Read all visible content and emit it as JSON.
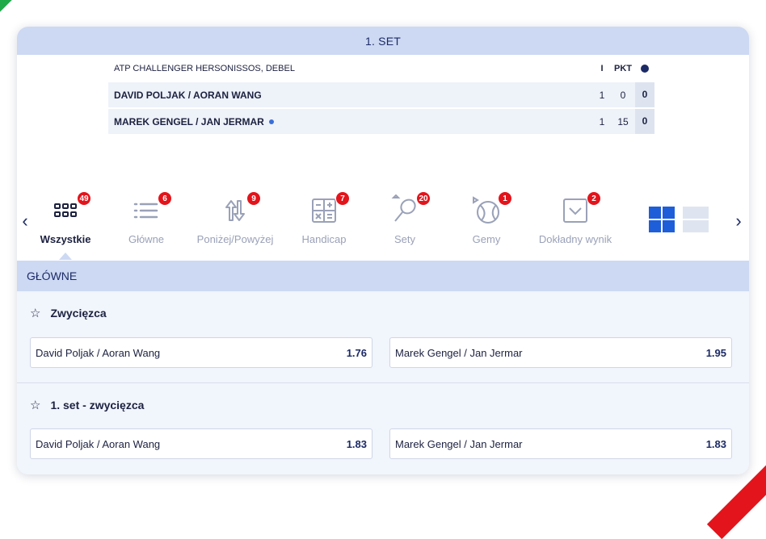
{
  "set_header": "1. SET",
  "score": {
    "tournament": "ATP CHALLENGER HERSONISSOS, DEBEL",
    "col1": "I",
    "col2": "PKT",
    "rows": [
      {
        "name": "DAVID POLJAK / AORAN WANG",
        "set": "1",
        "pts": "0",
        "games": "0",
        "serving": false
      },
      {
        "name": "MAREK GENGEL / JAN JERMAR",
        "set": "1",
        "pts": "15",
        "games": "0",
        "serving": true
      }
    ]
  },
  "tabs": [
    {
      "label": "Wszystkie",
      "badge": "49",
      "icon": "grid-icon",
      "active": true
    },
    {
      "label": "Główne",
      "badge": "6",
      "icon": "list-icon",
      "active": false
    },
    {
      "label": "Poniżej/Powyżej",
      "badge": "9",
      "icon": "updown-arrows-icon",
      "active": false
    },
    {
      "label": "Handicap",
      "badge": "7",
      "icon": "calculator-icon",
      "active": false
    },
    {
      "label": "Sety",
      "badge": "20",
      "icon": "tennis-racket-icon",
      "active": false
    },
    {
      "label": "Gemy",
      "badge": "1",
      "icon": "tennis-ball-icon",
      "active": false
    },
    {
      "label": "Dokładny wynik",
      "badge": "2",
      "icon": "checkbox-icon",
      "active": false
    }
  ],
  "section_title": "GŁÓWNE",
  "markets": [
    {
      "title": "Zwycięzca",
      "odds": [
        {
          "name": "David Poljak / Aoran Wang",
          "value": "1.76"
        },
        {
          "name": "Marek Gengel / Jan Jermar",
          "value": "1.95"
        }
      ]
    },
    {
      "title": "1. set - zwycięzca",
      "odds": [
        {
          "name": "David Poljak / Aoran Wang",
          "value": "1.83"
        },
        {
          "name": "Marek Gengel / Jan Jermar",
          "value": "1.83"
        }
      ]
    }
  ],
  "colors": {
    "accent": "#1f5ed9",
    "header_bg": "#cdd9f3",
    "badge": "#e3141b",
    "green": "#1faa4a"
  }
}
